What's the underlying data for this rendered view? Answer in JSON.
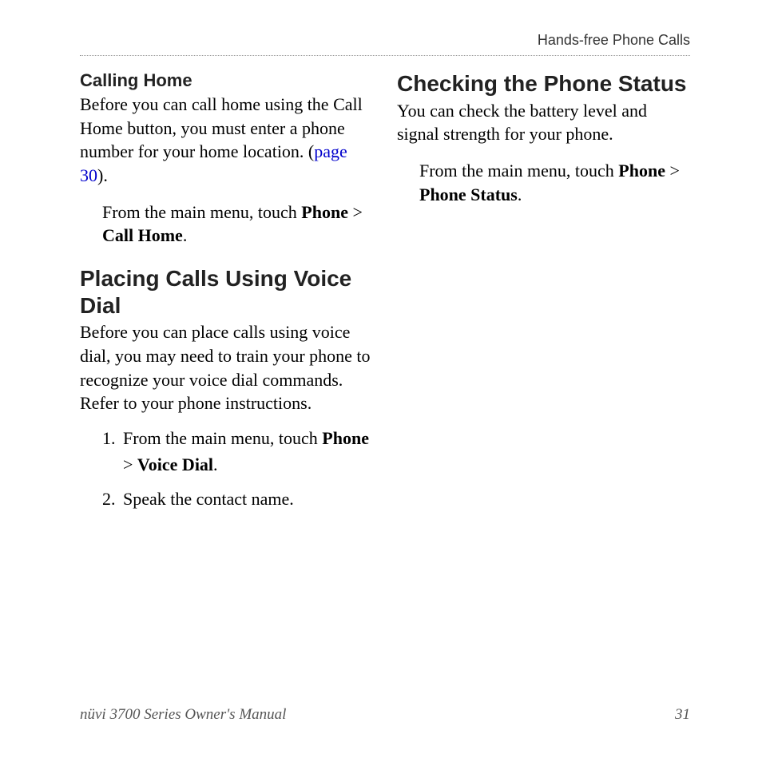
{
  "header": {
    "title": "Hands-free Phone Calls"
  },
  "left": {
    "calling_home": {
      "title": "Calling Home",
      "para_pre": "Before you can call home using the Call Home button, you must enter a phone number for your home location. (",
      "link": "page 30",
      "para_post": ").",
      "instruction_lead": "From the main menu, touch ",
      "bold1": "Phone",
      "sep": " > ",
      "bold2": "Call Home",
      "tail": "."
    },
    "voice_dial": {
      "title": "Placing Calls Using Voice Dial",
      "para": "Before you can place calls using voice dial, you may need to train your phone to recognize your voice dial commands. Refer to your phone instructions.",
      "steps": [
        {
          "num": "1.",
          "text_lead": "From the main menu, touch ",
          "bold1": "Phone",
          "sep": " > ",
          "bold2": "Voice Dial",
          "tail": "."
        },
        {
          "num": "2.",
          "text_full": "Speak the contact name."
        }
      ]
    }
  },
  "right": {
    "status": {
      "title": "Checking the Phone Status",
      "para": "You can check the battery level and signal strength for your phone.",
      "instruction_lead": "From the main menu, touch ",
      "bold1": "Phone",
      "sep": " > ",
      "bold2": "Phone Status",
      "tail": "."
    }
  },
  "footer": {
    "manual": "nüvi 3700 Series Owner's Manual",
    "page": "31"
  }
}
